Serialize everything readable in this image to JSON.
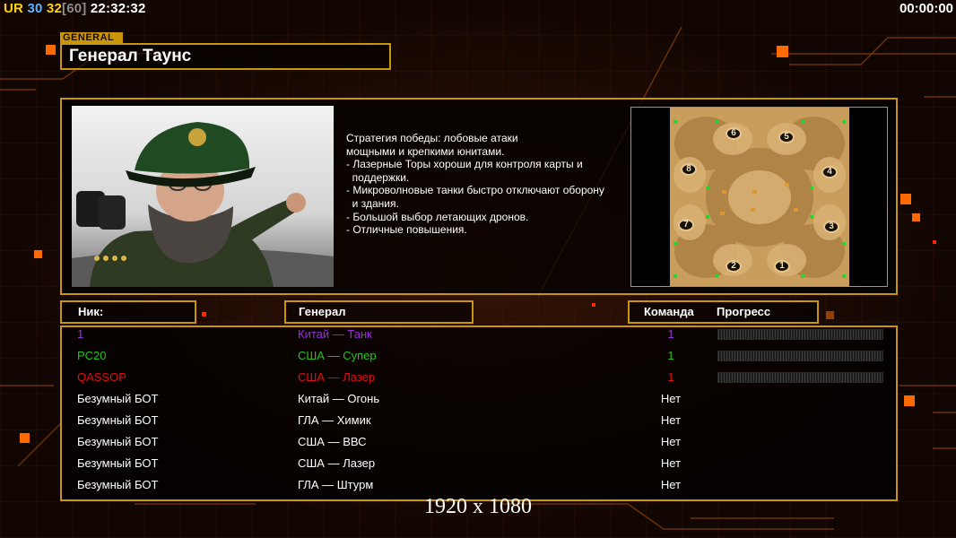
{
  "hud": {
    "ur_label": "UR",
    "fps_current": "30",
    "fps_avg": "32",
    "fps_cap": "[60]",
    "clock": "22:32:32",
    "game_timer": "00:00:00"
  },
  "general": {
    "tag": "GENERAL",
    "name": "Генерал Таунс"
  },
  "description": [
    "Стратегия победы: лобовые атаки",
    "мощными и крепкими юнитами.",
    "",
    "- Лазерные Торы хороши для контроля карты и",
    "  поддержки.",
    "- Микроволновые танки быстро отключают оборону",
    "  и здания.",
    "",
    "- Большой выбор летающих дронов.",
    "- Отличные повышения."
  ],
  "map": {
    "spawns": [
      "1",
      "2",
      "3",
      "4",
      "5",
      "6",
      "7",
      "8"
    ]
  },
  "table": {
    "headers": {
      "nick": "Ник:",
      "general": "Генерал",
      "team": "Команда",
      "progress": "Прогресс"
    },
    "rows": [
      {
        "nick": "1",
        "general": "Китай — Танк",
        "team": "1",
        "color": "#9b30e0",
        "progress": true
      },
      {
        "nick": "PC20",
        "general": "США — Супер",
        "team": "1",
        "color": "#27c21f",
        "progress": true
      },
      {
        "nick": "QASSOP",
        "general": "США — Лазер",
        "team": "1",
        "color": "#e01010",
        "progress": true
      },
      {
        "nick": "Безумный БОТ",
        "general": "Китай — Огонь",
        "team": "Нет",
        "color": "#ffffff",
        "progress": false
      },
      {
        "nick": "Безумный БОТ",
        "general": "ГЛА — Химик",
        "team": "Нет",
        "color": "#ffffff",
        "progress": false
      },
      {
        "nick": "Безумный БОТ",
        "general": "США — ВВС",
        "team": "Нет",
        "color": "#ffffff",
        "progress": false
      },
      {
        "nick": "Безумный БОТ",
        "general": "США — Лазер",
        "team": "Нет",
        "color": "#ffffff",
        "progress": false
      },
      {
        "nick": "Безумный БОТ",
        "general": "ГЛА — Штурм",
        "team": "Нет",
        "color": "#ffffff",
        "progress": false
      }
    ]
  },
  "resolution_label": "1920 x 1080",
  "colors": {
    "gold_border": "#c9950a",
    "background": "#120602"
  }
}
